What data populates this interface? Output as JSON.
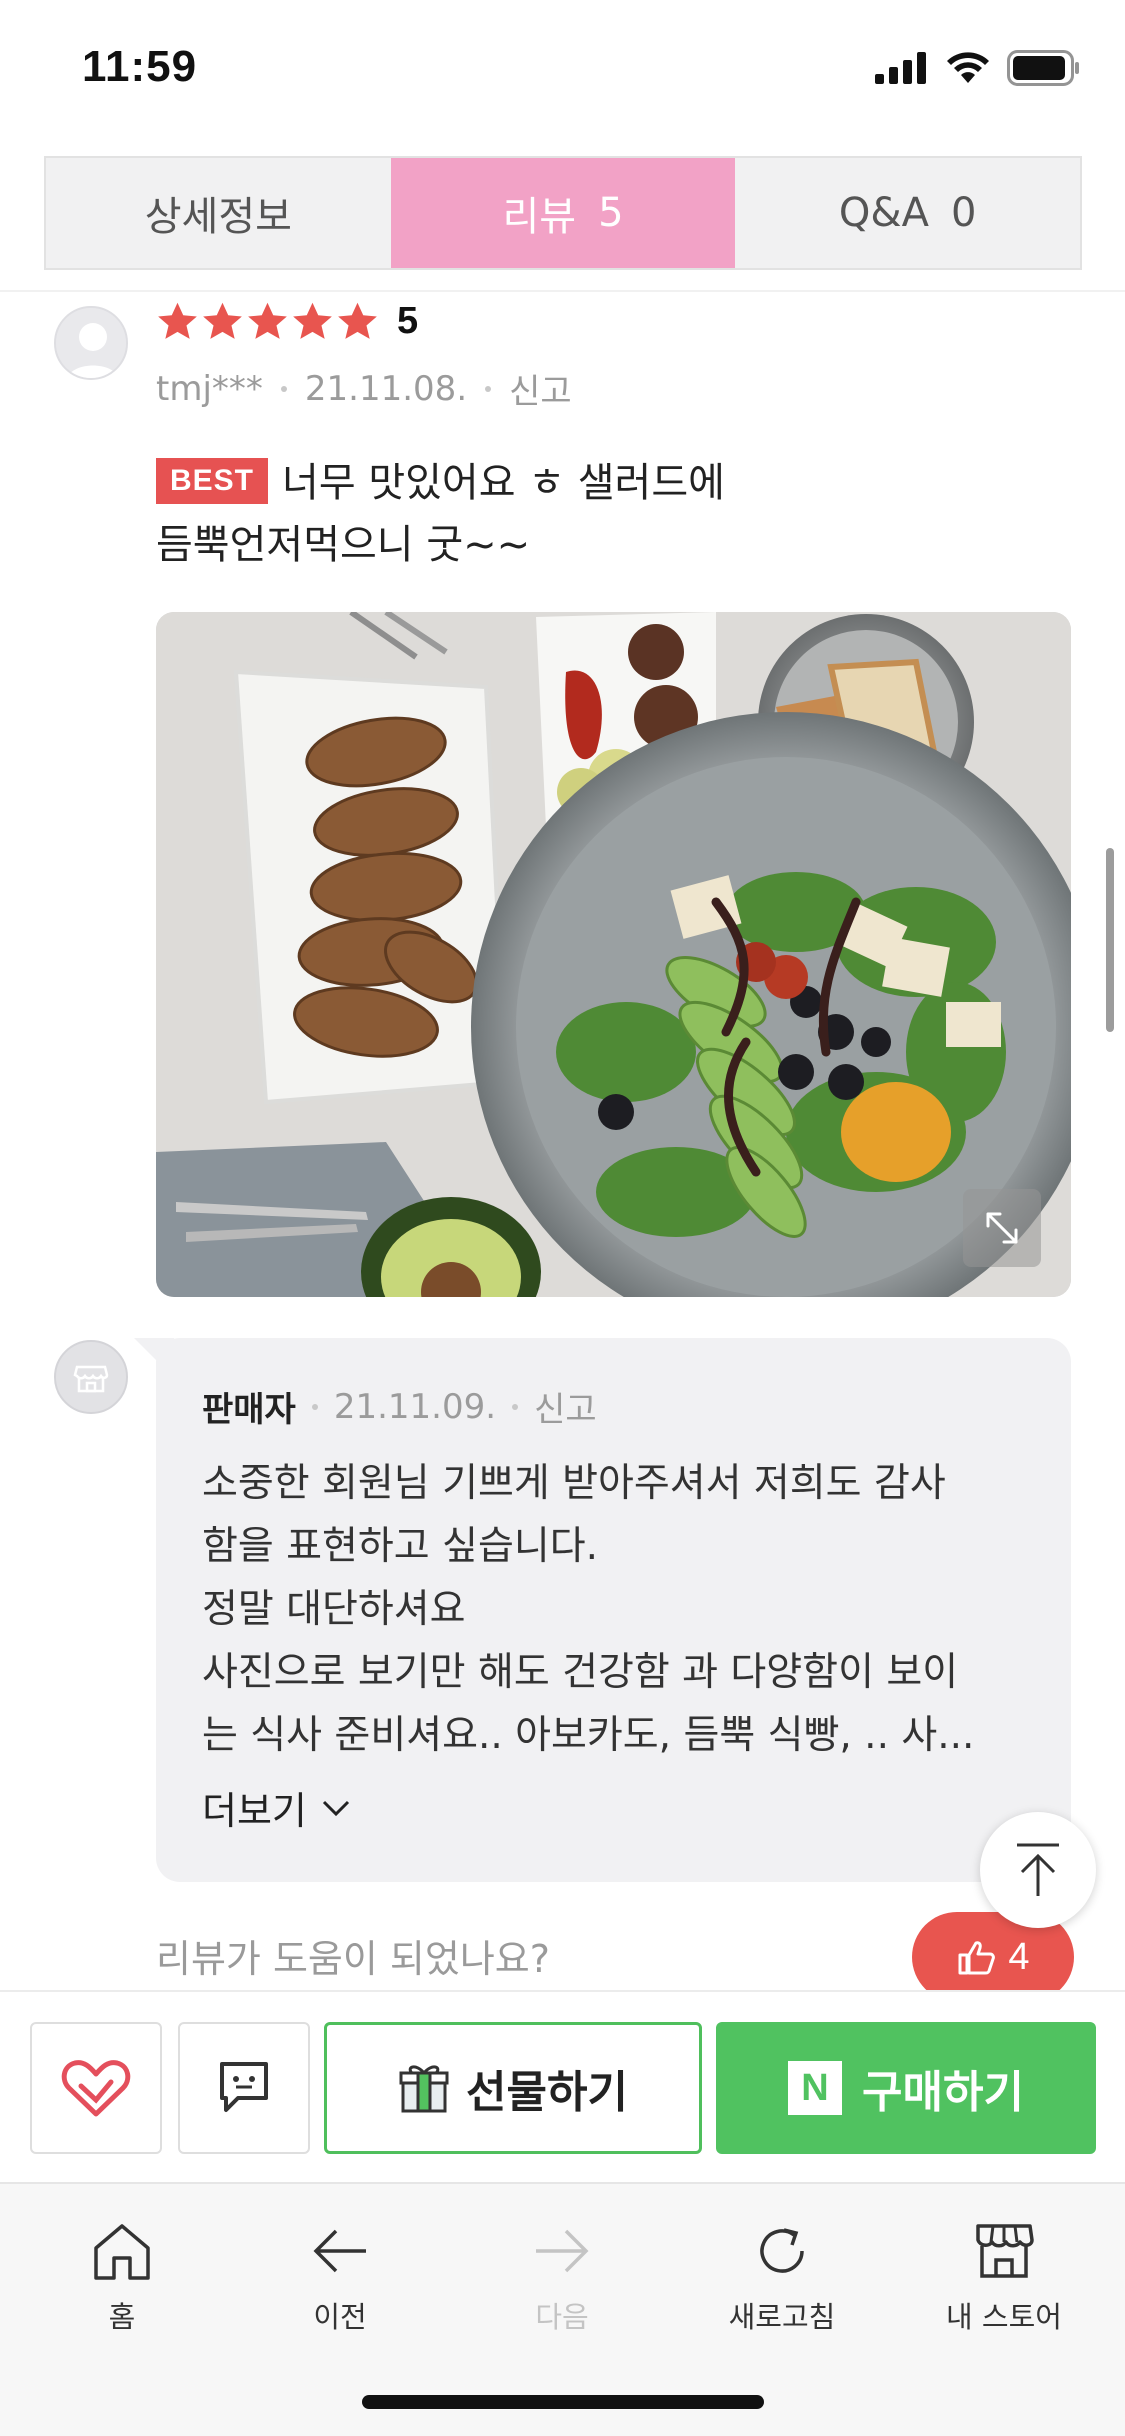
{
  "status_bar": {
    "time": "11:59"
  },
  "tabs": [
    {
      "label": "상세정보",
      "count": ""
    },
    {
      "label": "리뷰",
      "count": "5"
    },
    {
      "label": "Q&A",
      "count": "0"
    }
  ],
  "review": {
    "rating": 5,
    "rating_text": "5",
    "author": "tmj***",
    "date": "21.11.08.",
    "report": "신고",
    "badge": "BEST",
    "text_line1": "너무 맛있어요 ㅎ 샐러드에",
    "text_line2": "듬뿍언저먹으니 굿~~"
  },
  "seller_reply": {
    "author": "판매자",
    "date": "21.11.09.",
    "report": "신고",
    "lines": [
      "소중한 회원님 기쁘게 받아주셔서 저희도 감사",
      "함을 표현하고 싶습니다.",
      "정말 대단하셔요",
      "사진으로 보기만 해도 건강함 과 다양함이 보이",
      "는 식사 준비셔요.. 아보카도, 듬뿍 식빵, .. 사..."
    ],
    "more_label": "더보기"
  },
  "helpful": {
    "question": "리뷰가 도움이 되었나요?",
    "like_count": "4"
  },
  "purchase_bar": {
    "gift_label": "선물하기",
    "buy_label": "구매하기",
    "buy_logo": "N"
  },
  "browser_nav": [
    {
      "label": "홈",
      "icon": "home-icon",
      "enabled": true
    },
    {
      "label": "이전",
      "icon": "back-arrow-icon",
      "enabled": true
    },
    {
      "label": "다음",
      "icon": "forward-arrow-icon",
      "enabled": false
    },
    {
      "label": "새로고침",
      "icon": "refresh-icon",
      "enabled": true
    },
    {
      "label": "내 스토어",
      "icon": "store-icon",
      "enabled": true
    }
  ],
  "colors": {
    "active_tab": "#f2a2c6",
    "star": "#e8554f",
    "best_badge": "#e65252",
    "buy_green": "#50c260",
    "like_red": "#e8554f"
  }
}
